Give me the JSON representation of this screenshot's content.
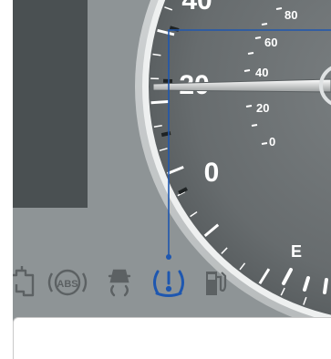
{
  "speedometer": {
    "inner_scale": [
      "80",
      "60",
      "40",
      "20",
      "0"
    ],
    "outer_scale": [
      "40",
      "20",
      "0"
    ]
  },
  "fuel_gauge": {
    "empty_mark": "E"
  },
  "warning_lights": {
    "abs_label": "ABS",
    "tpms_symbol": "(!)",
    "highlighted": "tire-pressure-warning-icon"
  },
  "colors": {
    "cluster_background": "#8e9496",
    "side_display": "#4a5052",
    "gauge_face": "#6f7476",
    "gauge_text": "#ffffff",
    "tpms_highlight": "#1e57b0",
    "callout_line": "#1e57b0"
  }
}
